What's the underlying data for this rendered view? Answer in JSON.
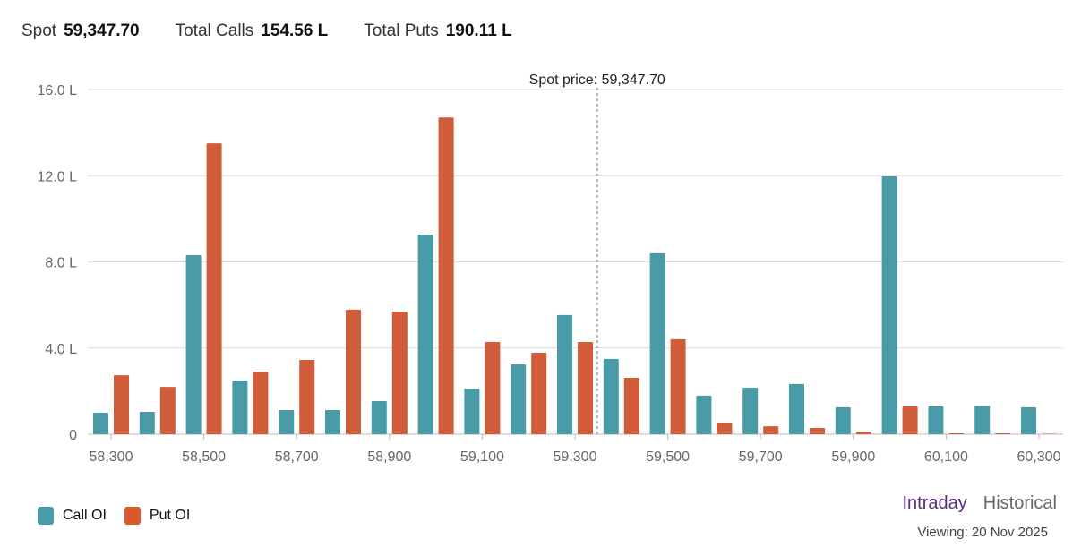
{
  "header": {
    "spot_label": "Spot",
    "spot_value": "59,347.70",
    "calls_label": "Total Calls",
    "calls_value": "154.56 L",
    "puts_label": "Total Puts",
    "puts_value": "190.11 L"
  },
  "chart_data": {
    "type": "bar",
    "categories": [
      "58,300",
      "58,400",
      "58,500",
      "58,600",
      "58,700",
      "58,800",
      "58,900",
      "59,000",
      "59,100",
      "59,200",
      "59,300",
      "59,400",
      "59,500",
      "59,600",
      "59,700",
      "59,800",
      "59,900",
      "60,000",
      "60,100",
      "60,200",
      "60,300"
    ],
    "series": [
      {
        "name": "Call OI",
        "color": "#4a9ba8",
        "values": [
          1.0,
          1.04,
          8.31,
          2.49,
          1.12,
          1.12,
          1.54,
          9.27,
          2.12,
          3.24,
          5.53,
          3.49,
          8.4,
          1.79,
          2.16,
          2.33,
          1.25,
          11.97,
          1.29,
          1.33,
          1.25
        ]
      },
      {
        "name": "Put OI",
        "color": "#d05c3a",
        "values": [
          2.74,
          2.2,
          13.5,
          2.9,
          3.45,
          5.78,
          5.69,
          14.7,
          4.28,
          3.78,
          4.28,
          2.62,
          4.41,
          0.54,
          0.37,
          0.29,
          0.12,
          1.29,
          0.04,
          0.04,
          0.02
        ]
      }
    ],
    "unit": "L",
    "ylim": [
      0,
      16
    ],
    "yticks": [
      "0",
      "4.0 L",
      "8.0 L",
      "12.0 L",
      "16.0 L"
    ],
    "xticks": [
      "58,300",
      "58,500",
      "58,700",
      "58,900",
      "59,100",
      "59,300",
      "59,500",
      "59,700",
      "59,900",
      "60,100",
      "60,300"
    ],
    "spot": 59347.7,
    "spot_annotation": "Spot price: 59,347.70",
    "legend": "bottom-left"
  },
  "controls": {
    "intraday": "Intraday",
    "historical": "Historical",
    "viewing": "Viewing: 20 Nov 2025",
    "intraday_color": "#5b2a86",
    "historical_color": "#666666"
  }
}
